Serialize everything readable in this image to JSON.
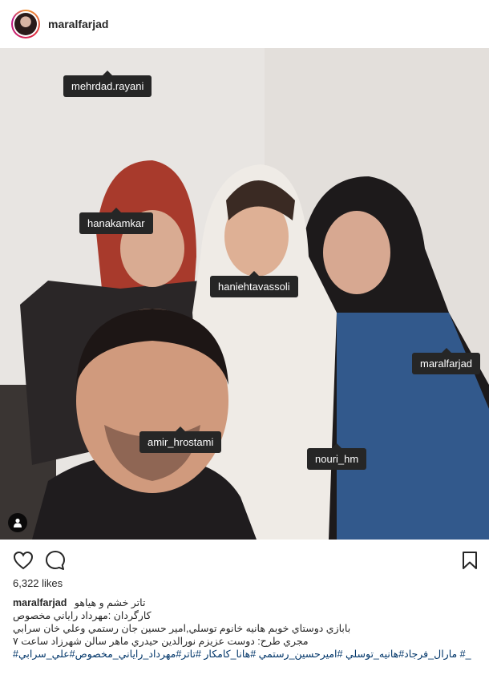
{
  "header": {
    "username": "maralfarjad"
  },
  "tags": [
    {
      "label": "mehrdad.rayani"
    },
    {
      "label": "hanakamkar"
    },
    {
      "label": "haniehtavassoli"
    },
    {
      "label": "maralfarjad"
    },
    {
      "label": "amir_hrostami"
    },
    {
      "label": "nouri_hm"
    }
  ],
  "icons": {
    "like": "heart-outline-icon",
    "comment": "speech-bubble-icon",
    "save": "bookmark-icon",
    "user": "person-icon"
  },
  "likes": "6,322 likes",
  "caption": {
    "username": "maralfarjad",
    "line1": "تاتر خشم و هياهو",
    "line2": "كارگردان :مهرداد راياني مخصوص",
    "line3": "بابازي دوستاي خوبم هانيه خانوم توسلي,امير حسين جان رستمي وعلي خان سرابي",
    "line4": "مجري طرح: دوست عزيزم نورالدين حيدري ماهر سالن شهرزاد ساعت ٧",
    "hashtags": "_# مارال_فرجاد#هانيه_توسلي #اميرحسين_رستمي #هانا_كامكار #تاتر#مهرداد_راياني_مخصوص#علي_سرابي#"
  }
}
